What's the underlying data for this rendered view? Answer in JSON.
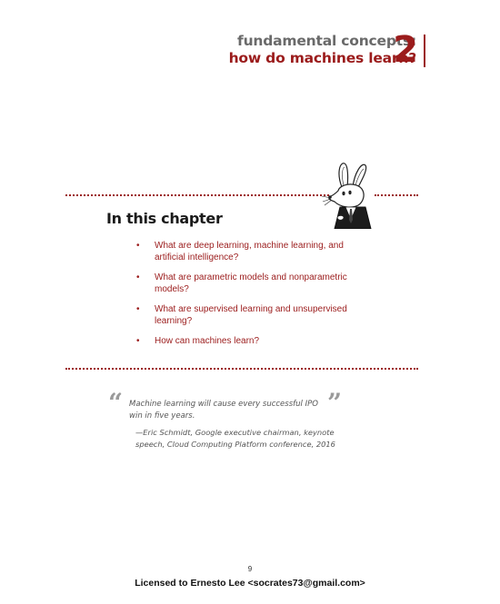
{
  "chapter": {
    "subtitle": "fundamental concepts:",
    "title": "how do machines learn?",
    "number": "2"
  },
  "contents": {
    "heading": "In this chapter",
    "bullet": "•",
    "items": [
      "What are deep learning, machine learning, and artificial intelligence?",
      "What are parametric models and nonparametric models?",
      "What are supervised learning and unsupervised learning?",
      "How can machines learn?"
    ]
  },
  "epigraph": {
    "open_mark": "“",
    "close_mark": "”",
    "text": "Machine learning will cause every successful IPO win in five years.",
    "attribution": "—Eric Schmidt, Google executive chairman, keynote speech, Cloud Computing Platform conference, 2016"
  },
  "footer": {
    "page_number": "9",
    "license": "Licensed to Ernesto Lee <socrates73@gmail.com>"
  },
  "colors": {
    "accent": "#9b1c1c",
    "gray_text": "#6a6a6a"
  },
  "icons": {
    "mascot": "mouse-mascot-icon"
  }
}
